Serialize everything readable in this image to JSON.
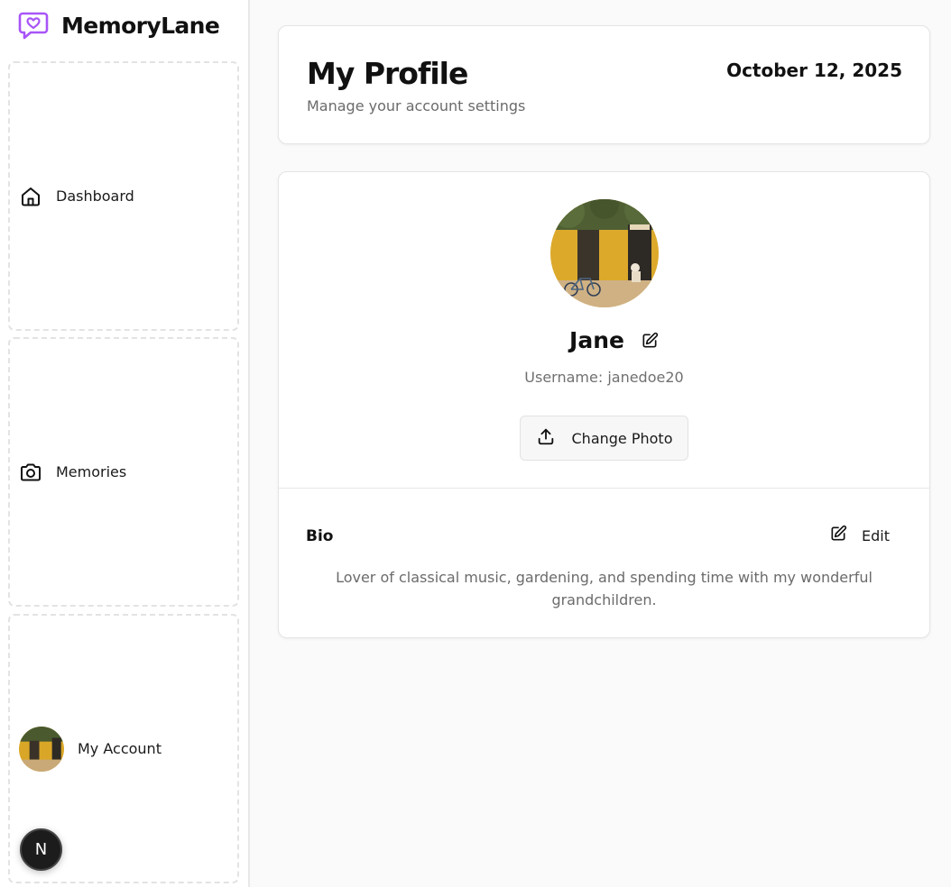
{
  "app": {
    "name": "MemoryLane",
    "logo_icon": "heart-chat-icon",
    "accent": "#a855f7"
  },
  "sidebar": {
    "items": [
      {
        "label": "Dashboard",
        "icon": "home-icon"
      },
      {
        "label": "Memories",
        "icon": "camera-icon"
      },
      {
        "label": "My Account",
        "icon": "avatar"
      }
    ]
  },
  "floating_badge": {
    "label": "N"
  },
  "header": {
    "title": "My Profile",
    "subtitle": "Manage your account settings",
    "date": "October 12, 2025"
  },
  "profile": {
    "name": "Jane",
    "username_line": "Username: janedoe20",
    "change_photo_label": "Change Photo",
    "bio_label": "Bio",
    "edit_label": "Edit",
    "bio_text": "Lover of classical music, gardening, and spending time with my wonderful grandchildren."
  }
}
